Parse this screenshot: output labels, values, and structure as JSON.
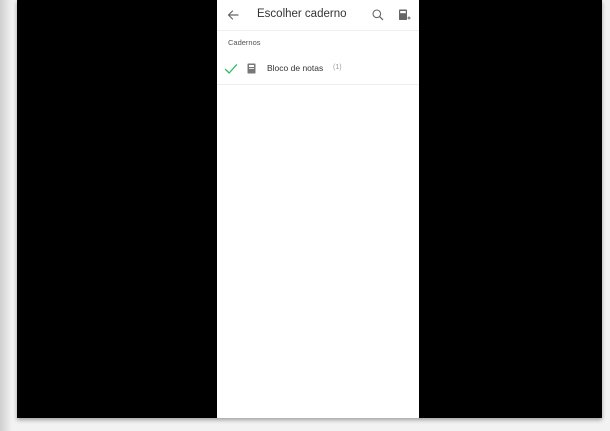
{
  "header": {
    "title": "Escolher caderno",
    "back_icon": "arrow-left-icon",
    "search_icon": "search-icon",
    "new_notebook_icon": "new-notebook-icon"
  },
  "section": {
    "label": "Cadernos"
  },
  "notebooks": [
    {
      "name": "Bloco de notas",
      "count": "(1)",
      "selected": true,
      "check_color": "#2dbe60",
      "icon": "notebook-icon"
    }
  ]
}
